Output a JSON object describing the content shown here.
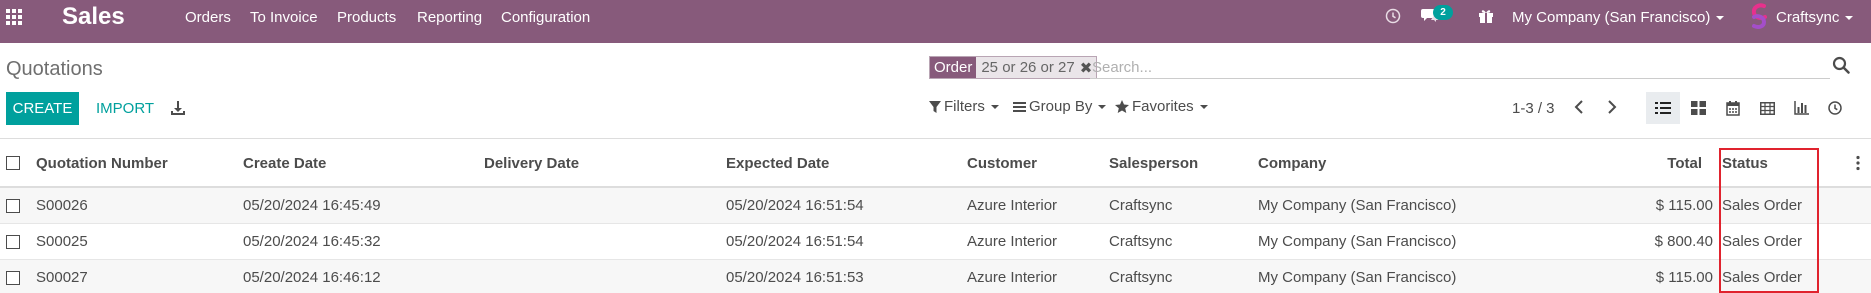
{
  "app": {
    "name": "Sales"
  },
  "menu": [
    "Orders",
    "To Invoice",
    "Products",
    "Reporting",
    "Configuration"
  ],
  "systray": {
    "activity_icon": "clock-icon",
    "messages_icon": "chat-icon",
    "messages_count": "2",
    "gift_icon": "gift-icon",
    "company": "My Company (San Francisco)",
    "user": "Craftsync"
  },
  "control_panel": {
    "title": "Quotations",
    "facet": {
      "label": "Order",
      "values": "25 or 26 or 27"
    },
    "search_placeholder": "Search...",
    "create_label": "CREATE",
    "import_label": "IMPORT",
    "filters_label": "Filters",
    "groupby_label": "Group By",
    "favorites_label": "Favorites",
    "pager": "1-3 / 3",
    "views": [
      "list-view-icon",
      "kanban-view-icon",
      "calendar-view-icon",
      "pivot-view-icon",
      "graph-view-icon",
      "activity-view-icon"
    ],
    "active_view": "list-view-icon"
  },
  "table": {
    "columns": {
      "number": "Quotation Number",
      "create_date": "Create Date",
      "delivery_date": "Delivery Date",
      "expected_date": "Expected Date",
      "customer": "Customer",
      "salesperson": "Salesperson",
      "company": "Company",
      "total": "Total",
      "status": "Status"
    },
    "rows": [
      {
        "number": "S00026",
        "create_date": "05/20/2024 16:45:49",
        "delivery_date": "",
        "expected_date": "05/20/2024 16:51:54",
        "customer": "Azure Interior",
        "salesperson": "Craftsync",
        "company": "My Company (San Francisco)",
        "total": "$ 115.00",
        "status": "Sales Order"
      },
      {
        "number": "S00025",
        "create_date": "05/20/2024 16:45:32",
        "delivery_date": "",
        "expected_date": "05/20/2024 16:51:54",
        "customer": "Azure Interior",
        "salesperson": "Craftsync",
        "company": "My Company (San Francisco)",
        "total": "$ 800.40",
        "status": "Sales Order"
      },
      {
        "number": "S00027",
        "create_date": "05/20/2024 16:46:12",
        "delivery_date": "",
        "expected_date": "05/20/2024 16:51:53",
        "customer": "Azure Interior",
        "salesperson": "Craftsync",
        "company": "My Company (San Francisco)",
        "total": "$ 115.00",
        "status": "Sales Order"
      }
    ]
  },
  "colors": {
    "navbar": "#875a7b",
    "primary": "#00a09d",
    "highlight": "#e0232e"
  }
}
